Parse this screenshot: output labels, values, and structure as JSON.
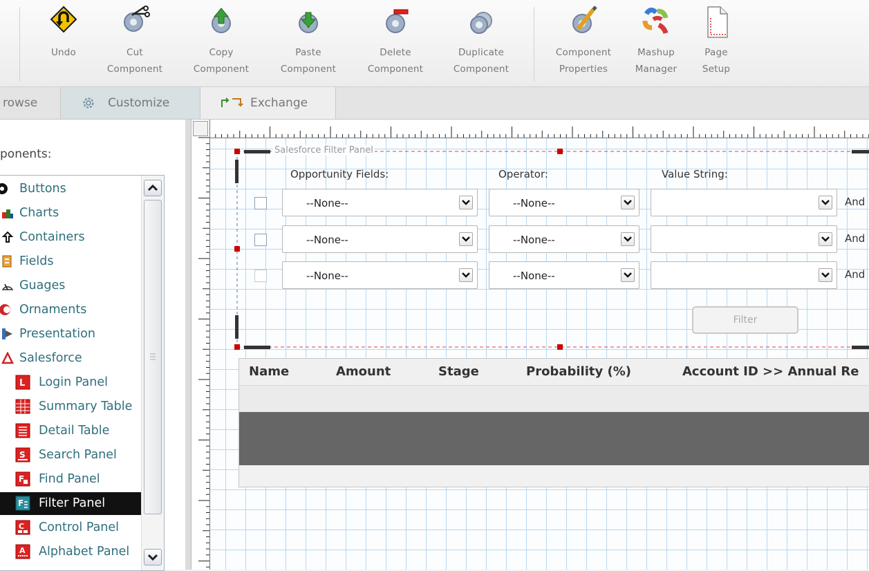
{
  "toolbar": {
    "buttons": [
      {
        "label": "Undo",
        "icon": "undo-icon"
      },
      {
        "label": "Cut\nComponent",
        "icon": "cut-component-icon"
      },
      {
        "label": "Copy\nComponent",
        "icon": "copy-component-icon"
      },
      {
        "label": "Paste\nComponent",
        "icon": "paste-component-icon"
      },
      {
        "label": "Delete\nComponent",
        "icon": "delete-component-icon"
      },
      {
        "label": "Duplicate\nComponent",
        "icon": "duplicate-component-icon"
      },
      {
        "label": "Component\nProperties",
        "icon": "component-properties-icon"
      },
      {
        "label": "Mashup\nManager",
        "icon": "mashup-manager-icon"
      },
      {
        "label": "Page\nSetup",
        "icon": "page-setup-icon"
      }
    ]
  },
  "tabs": [
    {
      "label": "rowse"
    },
    {
      "label": "Customize",
      "icon": "gear-icon"
    },
    {
      "label": "Exchange",
      "icon": "exchange-icon"
    }
  ],
  "left_panel": {
    "title": "ponents:",
    "tree": [
      {
        "label": "Buttons",
        "icon": "buttons-icon"
      },
      {
        "label": "Charts",
        "icon": "charts-icon"
      },
      {
        "label": "Containers",
        "icon": "containers-icon"
      },
      {
        "label": "Fields",
        "icon": "fields-icon"
      },
      {
        "label": "Guages",
        "icon": "guages-icon"
      },
      {
        "label": "Ornaments",
        "icon": "ornaments-icon"
      },
      {
        "label": "Presentation",
        "icon": "presentation-icon"
      },
      {
        "label": "Salesforce",
        "icon": "salesforce-icon"
      },
      {
        "label": "Login Panel",
        "icon": "login-panel-icon"
      },
      {
        "label": "Summary Table",
        "icon": "summary-table-icon"
      },
      {
        "label": "Detail Table",
        "icon": "detail-table-icon"
      },
      {
        "label": "Search Panel",
        "icon": "search-panel-icon"
      },
      {
        "label": "Find Panel",
        "icon": "find-panel-icon"
      },
      {
        "label": "Filter Panel",
        "icon": "filter-panel-icon",
        "selected": true
      },
      {
        "label": "Control Panel",
        "icon": "control-panel-icon"
      },
      {
        "label": "Alphabet Panel",
        "icon": "alphabet-panel-icon"
      }
    ]
  },
  "filter_panel": {
    "title": "Salesforce Filter Panel",
    "col_fields": "Opportunity Fields:",
    "col_operator": "Operator:",
    "col_value": "Value String:",
    "rows": [
      {
        "field": "--None--",
        "operator": "--None--",
        "value": "",
        "conj": "And"
      },
      {
        "field": "--None--",
        "operator": "--None--",
        "value": "",
        "conj": "And"
      },
      {
        "field": "--None--",
        "operator": "--None--",
        "value": "",
        "conj": "And"
      }
    ],
    "filter_button": "Filter"
  },
  "data_table": {
    "columns": [
      "Name",
      "Amount",
      "Stage",
      "Probability (%)",
      "Account ID >> Annual Re"
    ]
  }
}
